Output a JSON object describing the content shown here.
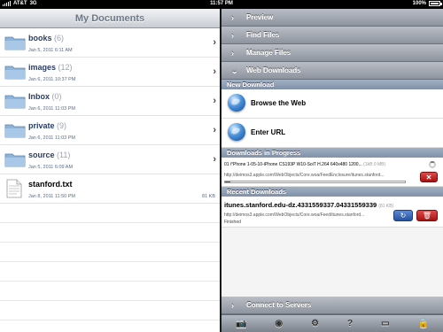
{
  "status_bar": {
    "carrier": "AT&T",
    "network": "3G",
    "time": "11:57 PM",
    "battery": "100%"
  },
  "left": {
    "title": "My Documents",
    "items": [
      {
        "name": "books",
        "count": "(6)",
        "date": "Jan 5, 2011 6:11 AM",
        "type": "folder"
      },
      {
        "name": "images",
        "count": "(12)",
        "date": "Jan 6, 2011 10:37 PM",
        "type": "folder"
      },
      {
        "name": "Inbox",
        "count": "(0)",
        "date": "Jan 6, 2011 11:03 PM",
        "type": "folder"
      },
      {
        "name": "private",
        "count": "(9)",
        "date": "Jan 6, 2011 11:03 PM",
        "type": "folder"
      },
      {
        "name": "source",
        "count": "(11)",
        "date": "Jan 5, 2011 6:09 AM",
        "type": "folder"
      },
      {
        "name": "stanford.txt",
        "date": "Jan 8, 2011 11:50 PM",
        "size": "81 KB",
        "type": "file"
      }
    ]
  },
  "right": {
    "sections": {
      "preview": "Preview",
      "find": "Find Files",
      "manage": "Manage Files",
      "web": "Web Downloads",
      "connect": "Connect to Servers"
    },
    "new_download": {
      "header": "New Download",
      "browse": "Browse the Web",
      "enter_url": "Enter URL"
    },
    "in_progress": {
      "header": "Downloads in Progress",
      "title": "01 i*Phone 1-05-10-iPhone CS193P W10-SoiT H.264 640x480 1200...",
      "title_sub": "(1kB 0 MB)",
      "url": "http://deimos3.apple.com/WebObjects/Core.woa/FeedEnclosure/itunes.stanford...",
      "progress": 0.03,
      "cancel_icon": "✕"
    },
    "recent": {
      "header": "Recent Downloads",
      "title": "itunes.stanford.edu-dz.4331559337.04331559339",
      "size": "(81 KB)",
      "url": "http://deimos3.apple.com/WebObjects/Core.woa/Feed/itunes.stanford...",
      "status": "Finished",
      "retry_icon": "↻",
      "delete_icon": "🗑"
    },
    "toolbar": [
      "camera-icon",
      "wifi-icon",
      "gear-icon",
      "help-icon",
      "display-icon",
      "lock-icon"
    ]
  }
}
